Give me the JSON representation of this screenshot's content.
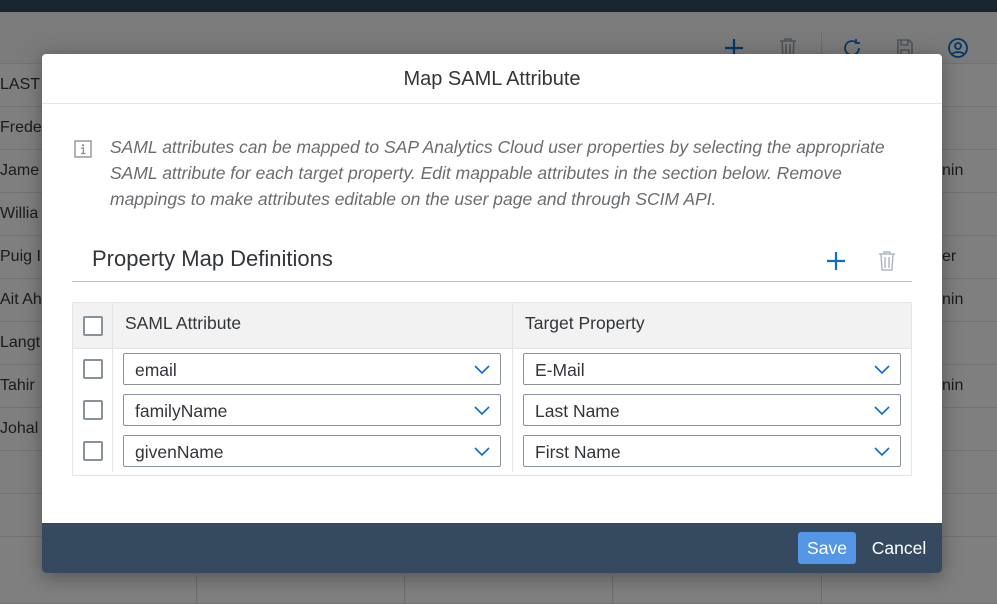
{
  "background": {
    "column_header": "LAST",
    "rows": [
      {
        "left": "Frede",
        "right": ""
      },
      {
        "left": "Jame",
        "right": "nin"
      },
      {
        "left": "Willia",
        "right": ""
      },
      {
        "left": "Puig I",
        "right": "er"
      },
      {
        "left": "Ait Ah",
        "right": "nin"
      },
      {
        "left": "Langt",
        "right": ""
      },
      {
        "left": "Tahir",
        "right": "nin"
      },
      {
        "left": "Johal",
        "right": ""
      }
    ],
    "toolbar_icons": [
      "add-icon",
      "delete-icon",
      "refresh-icon",
      "save-icon",
      "user-icon"
    ]
  },
  "dialog": {
    "title": "Map SAML Attribute",
    "info_text": "SAML attributes can be mapped to SAP Analytics Cloud user properties by selecting the appropriate SAML attribute for each target property. Edit mappable attributes in the section below. Remove mappings to make attributes editable on the user page and through SCIM API.",
    "section_title": "Property Map Definitions",
    "table": {
      "headers": {
        "saml": "SAML Attribute",
        "target": "Target Property"
      },
      "rows": [
        {
          "saml": "email",
          "target": "E-Mail"
        },
        {
          "saml": "familyName",
          "target": "Last Name"
        },
        {
          "saml": "givenName",
          "target": "First Name"
        }
      ]
    },
    "footer": {
      "save_label": "Save",
      "cancel_label": "Cancel"
    }
  },
  "colors": {
    "accent": "#0a6ed1",
    "footer_bg": "#354a5f",
    "save_button": "#5596e6"
  }
}
